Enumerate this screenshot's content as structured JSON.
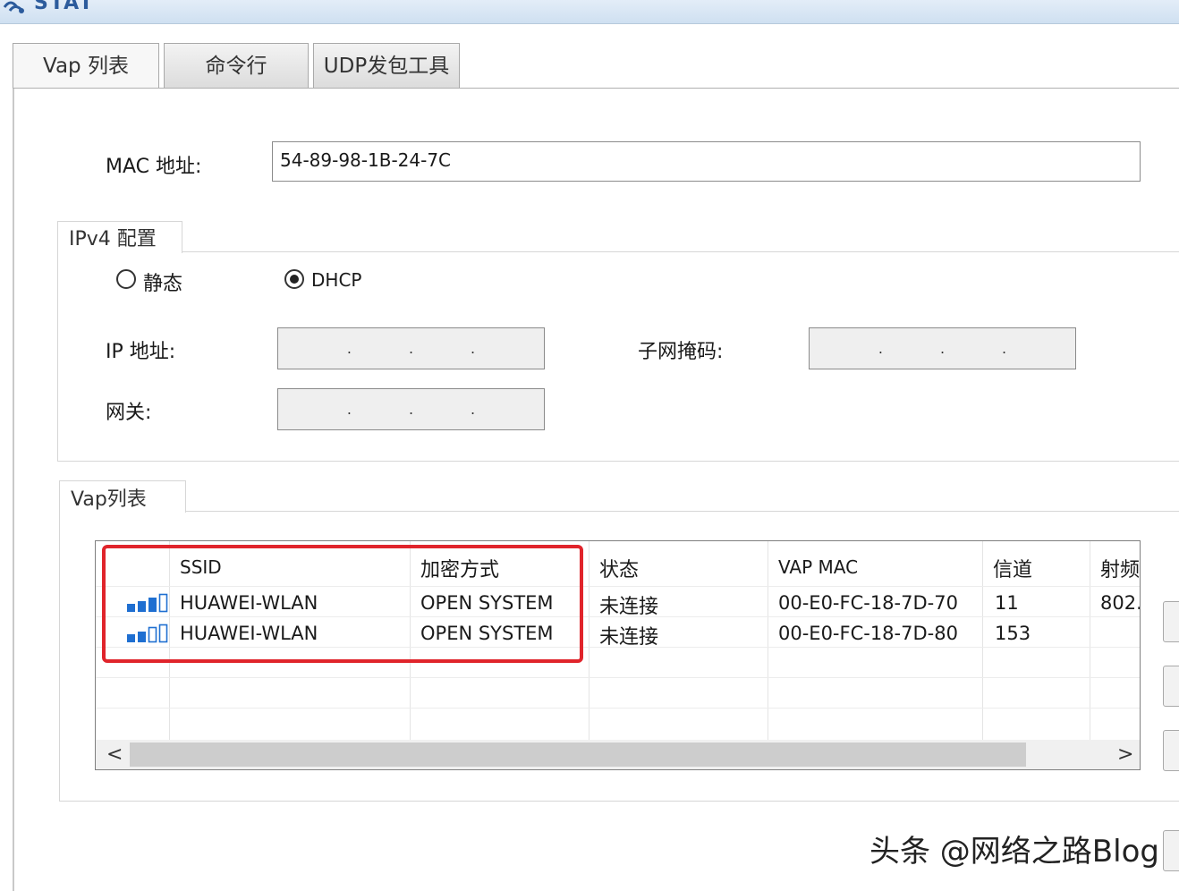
{
  "window": {
    "title": "STAT"
  },
  "tabs": [
    {
      "label": "Vap 列表"
    },
    {
      "label": "命令行"
    },
    {
      "label": "UDP发包工具"
    }
  ],
  "mac": {
    "label": "MAC 地址:",
    "value": "54-89-98-1B-24-7C"
  },
  "ipv4": {
    "group_title": "IPv4 配置",
    "mode_static": "静态",
    "mode_dhcp": "DHCP",
    "selected_mode": "DHCP",
    "ip_label": "IP 地址:",
    "mask_label": "子网掩码:",
    "gateway_label": "网关:",
    "ip_dots": [
      ".",
      ".",
      "."
    ],
    "mask_dots": [
      ".",
      ".",
      "."
    ],
    "gateway_dots": [
      ".",
      ".",
      "."
    ]
  },
  "vap": {
    "group_title": "Vap列表",
    "columns": [
      "SSID",
      "加密方式",
      "状态",
      "VAP MAC",
      "信道",
      "射频"
    ],
    "rows": [
      {
        "ssid": "HUAWEI-WLAN",
        "encryption": "OPEN SYSTEM",
        "status": "未连接",
        "vap_mac": "00-E0-FC-18-7D-70",
        "channel": "11",
        "radio": "802."
      },
      {
        "ssid": "HUAWEI-WLAN",
        "encryption": "OPEN SYSTEM",
        "status": "未连接",
        "vap_mac": "00-E0-FC-18-7D-80",
        "channel": "153",
        "radio": ""
      }
    ],
    "signal_bars": [
      3,
      2
    ],
    "scroll_left": "<",
    "scroll_right": ">"
  },
  "watermark": "头条 @网络之路Blog",
  "colors": {
    "highlight": "#e0242b",
    "signal": "#1f6fd1",
    "title": "#2c5b9c"
  }
}
